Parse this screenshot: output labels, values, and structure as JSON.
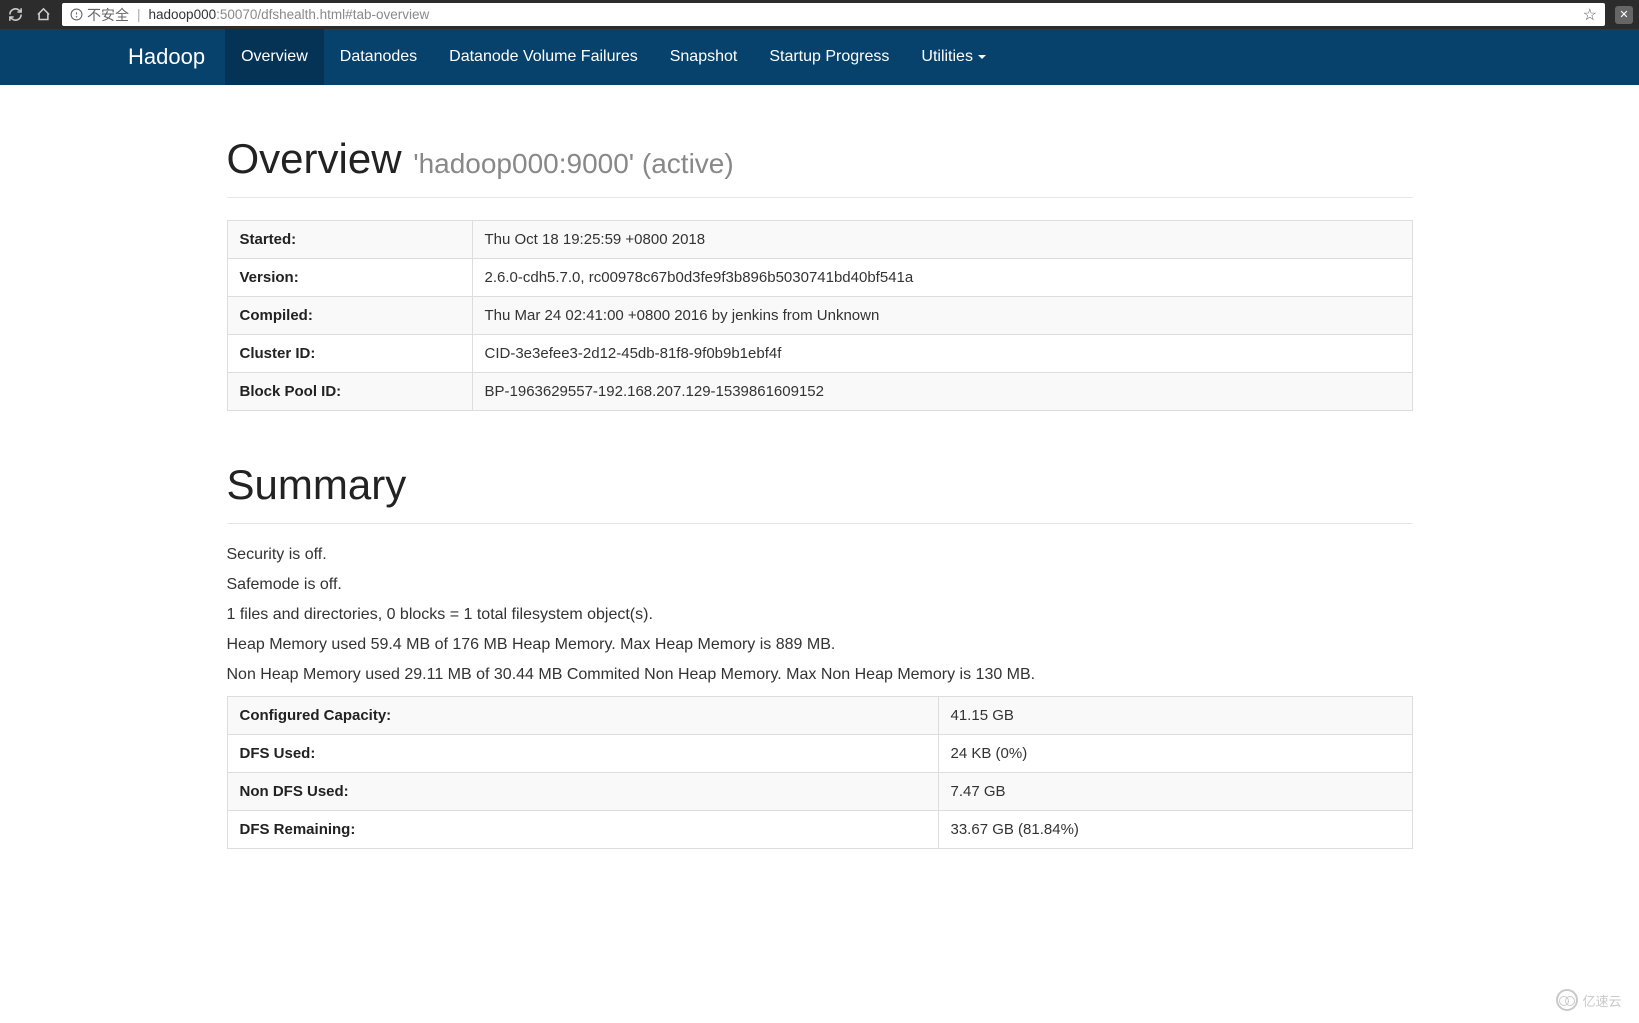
{
  "browser": {
    "insecure_label": "不安全",
    "url_host": "hadoop000",
    "url_rest": ":50070/dfshealth.html#tab-overview"
  },
  "nav": {
    "brand": "Hadoop",
    "items": [
      "Overview",
      "Datanodes",
      "Datanode Volume Failures",
      "Snapshot",
      "Startup Progress",
      "Utilities"
    ]
  },
  "overview": {
    "title": "Overview",
    "subtitle": "'hadoop000:9000' (active)",
    "rows": [
      {
        "label": "Started:",
        "value": "Thu Oct 18 19:25:59 +0800 2018"
      },
      {
        "label": "Version:",
        "value": "2.6.0-cdh5.7.0, rc00978c67b0d3fe9f3b896b5030741bd40bf541a"
      },
      {
        "label": "Compiled:",
        "value": "Thu Mar 24 02:41:00 +0800 2016 by jenkins from Unknown"
      },
      {
        "label": "Cluster ID:",
        "value": "CID-3e3efee3-2d12-45db-81f8-9f0b9b1ebf4f"
      },
      {
        "label": "Block Pool ID:",
        "value": "BP-1963629557-192.168.207.129-1539861609152"
      }
    ]
  },
  "summary": {
    "title": "Summary",
    "lines": [
      "Security is off.",
      "Safemode is off.",
      "1 files and directories, 0 blocks = 1 total filesystem object(s).",
      "Heap Memory used 59.4 MB of 176 MB Heap Memory. Max Heap Memory is 889 MB.",
      "Non Heap Memory used 29.11 MB of 30.44 MB Commited Non Heap Memory. Max Non Heap Memory is 130 MB."
    ],
    "rows": [
      {
        "label": "Configured Capacity:",
        "value": "41.15 GB"
      },
      {
        "label": "DFS Used:",
        "value": "24 KB (0%)"
      },
      {
        "label": "Non DFS Used:",
        "value": "7.47 GB"
      },
      {
        "label": "DFS Remaining:",
        "value": "33.67 GB (81.84%)"
      }
    ]
  },
  "watermark": "亿速云"
}
